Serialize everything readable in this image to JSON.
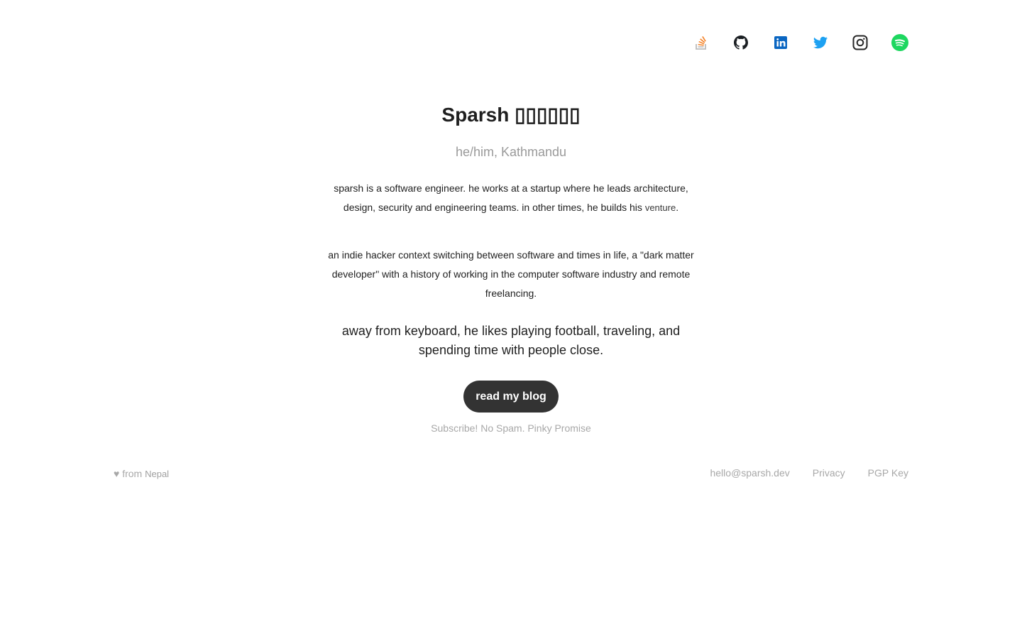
{
  "social": [
    {
      "name": "stackoverflow-icon",
      "color": "#f48024"
    },
    {
      "name": "github-icon",
      "color": "#1b1f23"
    },
    {
      "name": "linkedin-icon",
      "color": "#0a66c2"
    },
    {
      "name": "twitter-icon",
      "color": "#1da1f2"
    },
    {
      "name": "instagram-icon",
      "color": "#262626"
    },
    {
      "name": "spotify-icon",
      "color": "#1ed760"
    }
  ],
  "header": {
    "title": "Sparsh ▯▯▯▯▯▯",
    "subtitle": "he/him, Kathmandu"
  },
  "bio": {
    "p1_text": "sparsh is a software engineer. he works at a startup where he leads architecture, design, security and engineering teams. in other times, he builds his ",
    "p1_link": "venture",
    "p1_end": ".",
    "p2_text": "an indie hacker context switching between software and times in life, a \"dark matter developer\" with a history of working in the computer software industry and remote freelancing.",
    "afk": "away from keyboard, he likes playing football, traveling, and spending time with people close."
  },
  "cta": {
    "blog_label": "read my blog",
    "subscribe_label": "Subscribe! No Spam. Pinky Promise"
  },
  "footer": {
    "heart": "♥",
    "from_label": " from ",
    "country": "Nepal",
    "email": "hello@sparsh.dev",
    "privacy": "Privacy",
    "pgp": "PGP Key"
  }
}
